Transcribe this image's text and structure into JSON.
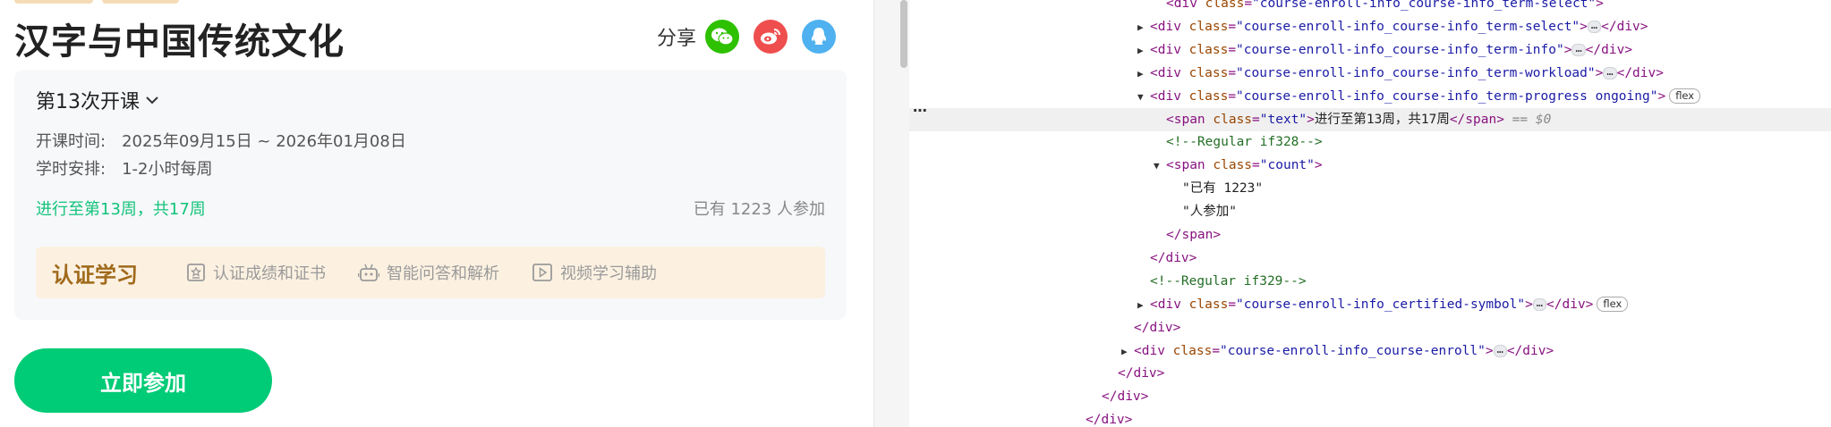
{
  "course": {
    "title": "汉字与中国传统文化",
    "share_label": "分享",
    "term_select": "第13次开课",
    "start_label": "开课时间:",
    "start_value": "2025年09月15日 ~ 2026年01月08日",
    "workload_label": "学时安排:",
    "workload_value": "1-2小时每周",
    "progress": "进行至第13周，共17周",
    "count": "已有 1223 人参加",
    "certified": {
      "title": "认证学习",
      "features": [
        "认证成绩和证书",
        "智能问答和解析",
        "视频学习辅助"
      ]
    },
    "enroll_button": "立即参加"
  },
  "colors": {
    "accent_green": "#00cb76",
    "progress_green": "#13c37a",
    "cert_brown": "#a06a1b",
    "wechat": "#2dc100",
    "weibo": "#ef4e4e",
    "qq": "#4fb1ef"
  },
  "icons": [
    "wechat-icon",
    "weibo-icon",
    "qq-icon",
    "chevron-down-icon",
    "certificate-icon",
    "robot-icon",
    "video-play-icon"
  ],
  "devtools": {
    "lines": [
      {
        "indent": 56,
        "tri": "",
        "html": "<span class='tag'>&lt;div</span> <span class='attr'>class</span>=<span class='val'>\"course-enroll-info_course-info_term-select\"</span><span class='tag'>&gt;</span>"
      },
      {
        "indent": 0,
        "tri": "▶",
        "open": "div",
        "cls": "course-enroll-info_course-info_term-select",
        "ell": true,
        "close": true
      },
      {
        "indent": 0,
        "tri": "▶",
        "open": "div",
        "cls": "course-enroll-info_course-info_term-info",
        "ell": true,
        "close": true
      },
      {
        "indent": 0,
        "tri": "▶",
        "open": "div",
        "cls": "course-enroll-info_course-info_term-workload",
        "ell": true,
        "close": true
      },
      {
        "indent": 0,
        "tri": "▼",
        "open": "div",
        "cls": "course-enroll-info_course-info_term-progress ongoing",
        "badge": "flex"
      },
      {
        "indent": 1,
        "tri": "",
        "span_text": "进行至第13周，共17周",
        "eq": "== $0",
        "selected": true
      },
      {
        "indent": 1,
        "tri": "",
        "comment": "<!--Regular if328-->"
      },
      {
        "indent": 1,
        "tri": "▼",
        "open": "span",
        "cls": "count"
      },
      {
        "indent": 2,
        "tri": "",
        "text": "\"已有 1223\""
      },
      {
        "indent": 2,
        "tri": "",
        "text": "\"人参加\""
      },
      {
        "indent": 1,
        "tri": "",
        "closing": "span"
      },
      {
        "indent": 0,
        "tri": "",
        "closing": "div"
      },
      {
        "indent": 0,
        "tri": "",
        "comment": "<!--Regular if329-->"
      },
      {
        "indent": 0,
        "tri": "▶",
        "open": "div",
        "cls": "course-enroll-info_certified-symbol",
        "ell": true,
        "close": true,
        "badge": "flex"
      },
      {
        "indent": -1,
        "tri": "",
        "closing": "div"
      },
      {
        "indent": -1,
        "tri": "▶",
        "open": "div",
        "cls": "course-enroll-info_course-enroll",
        "ell": true,
        "close": true
      },
      {
        "indent": -2,
        "tri": "",
        "closing": "div"
      },
      {
        "indent": -3,
        "tri": "",
        "closing": "div"
      },
      {
        "indent": -4,
        "tri": "",
        "closing": "div"
      }
    ]
  }
}
